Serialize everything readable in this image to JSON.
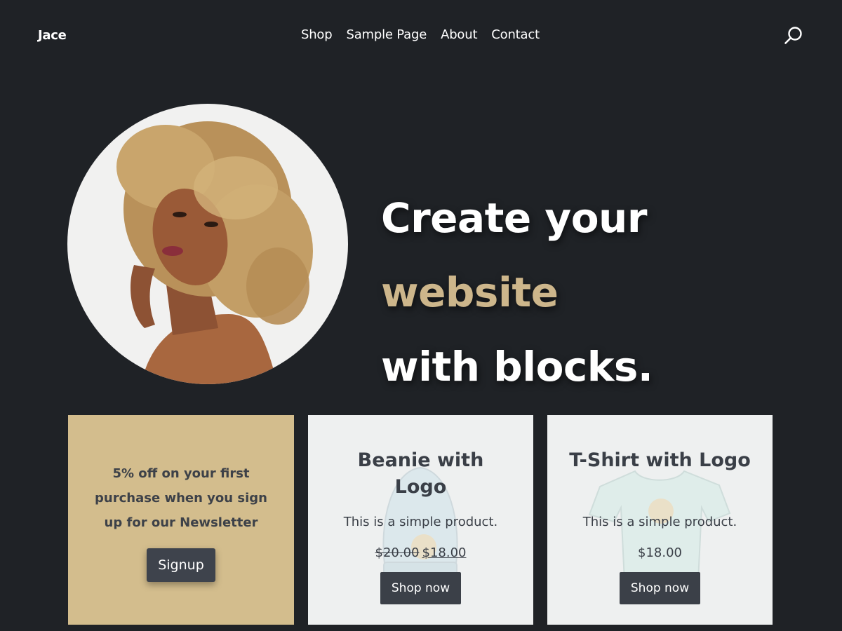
{
  "header": {
    "site_title": "Jace",
    "nav": [
      "Shop",
      "Sample Page",
      "About",
      "Contact"
    ],
    "search_icon": "search-icon"
  },
  "hero": {
    "heading_part1": "Create your ",
    "heading_accent": "website",
    "heading_part2": "with blocks.",
    "accent_color": "#cdb68b"
  },
  "newsletter": {
    "text": "5% off on your first purchase when you sign up for our Newsletter",
    "button_label": "Signup",
    "background": "#d3bd8d"
  },
  "products": [
    {
      "title": "Beanie with Logo",
      "description": "This is a simple product.",
      "price_regular": "$20.00",
      "price_sale": "$18.00",
      "button_label": "Shop now"
    },
    {
      "title": "T-Shirt with Logo",
      "description": "This is a simple product.",
      "price": "$18.00",
      "button_label": "Shop now"
    }
  ],
  "colors": {
    "background": "#1f2226",
    "card_light": "#eef0f0",
    "button_dark": "#3b4048"
  }
}
